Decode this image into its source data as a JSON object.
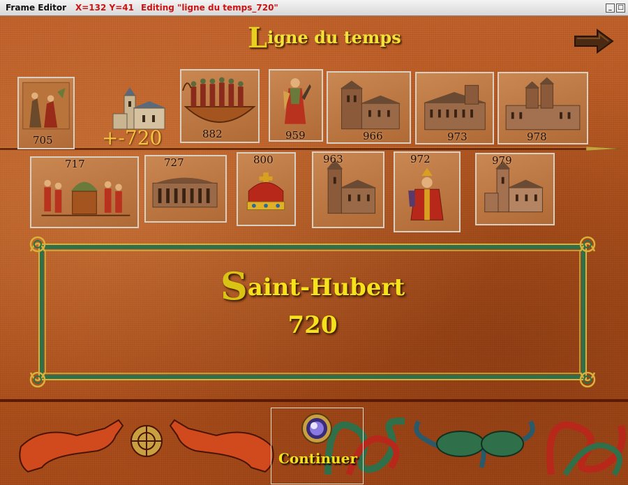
{
  "window": {
    "app_title": "Frame Editor",
    "coords": "X=132 Y=41",
    "editing": "Editing \"ligne du temps_720\"",
    "min_glyph": "_",
    "max_glyph": "□"
  },
  "page": {
    "title_initial": "L",
    "title_rest": "igne du temps",
    "next_icon": "arrow-right-icon"
  },
  "timeline": {
    "top_row": [
      {
        "year": "705",
        "icon": "illumination-figures"
      },
      {
        "year": "882",
        "icon": "viking-ship"
      },
      {
        "year": "959",
        "icon": "saint-figure"
      },
      {
        "year": "966",
        "icon": "abbey-church"
      },
      {
        "year": "973",
        "icon": "basilica"
      },
      {
        "year": "978",
        "icon": "monastery"
      }
    ],
    "bottom_row": [
      {
        "year": "717",
        "icon": "procession-scene"
      },
      {
        "year": "727",
        "icon": "colonnade-building"
      },
      {
        "year": "800",
        "icon": "crown"
      },
      {
        "year": "963",
        "icon": "tower-church"
      },
      {
        "year": "972",
        "icon": "bishop-figure"
      },
      {
        "year": "979",
        "icon": "romanesque-church"
      }
    ],
    "current_year": "+-720",
    "current_icon": "church-icon"
  },
  "event": {
    "name_initial": "S",
    "name_rest": "aint-Hubert",
    "year": "720"
  },
  "footer": {
    "continue_label": "Continuer",
    "continue_icon": "crystal-orb-icon"
  },
  "colors": {
    "background": "#b85a22",
    "gold_text": "#f5e11c",
    "frame_green": "#2f6f4a",
    "frame_gold": "#d8b23a"
  }
}
